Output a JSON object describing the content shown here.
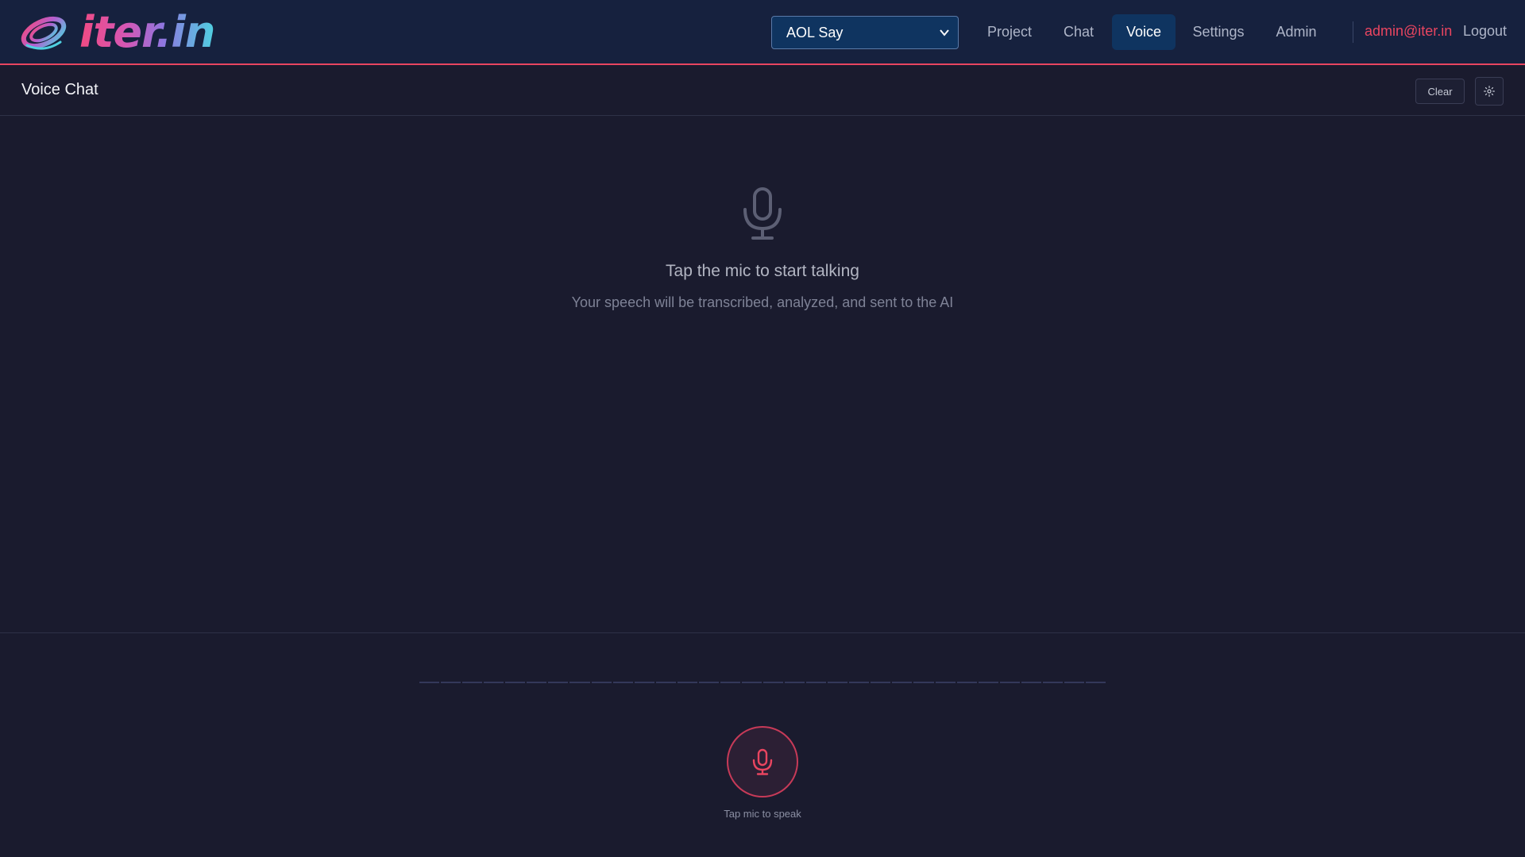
{
  "app": {
    "logo_text": "iter.in"
  },
  "nav": {
    "project_select": {
      "value": "AOL Say"
    },
    "items": [
      {
        "label": "Project",
        "active": false
      },
      {
        "label": "Chat",
        "active": false
      },
      {
        "label": "Voice",
        "active": true
      },
      {
        "label": "Settings",
        "active": false
      },
      {
        "label": "Admin",
        "active": false
      }
    ],
    "user_email": "admin@iter.in",
    "logout_label": "Logout"
  },
  "header": {
    "title": "Voice Chat",
    "clear_label": "Clear",
    "settings_icon": "gear-icon"
  },
  "empty_state": {
    "icon": "microphone-icon",
    "title": "Tap the mic to start talking",
    "subtitle": "Your speech will be transcribed, analyzed, and sent to the AI"
  },
  "mic_control": {
    "icon": "microphone-icon",
    "hint": "Tap mic to speak"
  },
  "colors": {
    "accent": "#e94560",
    "nav_bg": "#16213e",
    "active_bg": "#0f3460",
    "page_bg": "#1a1b2e"
  }
}
